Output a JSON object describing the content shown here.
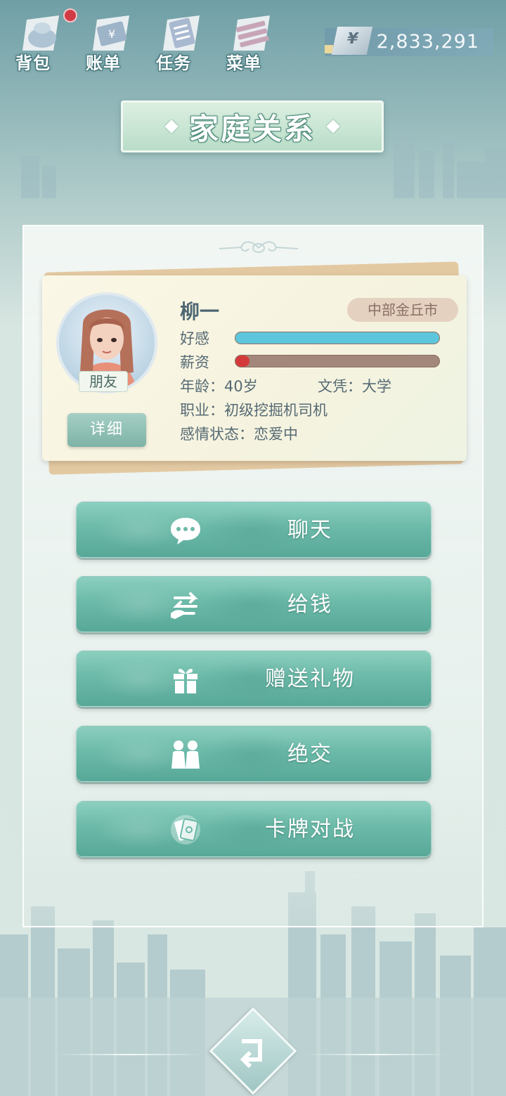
{
  "topnav": {
    "items": [
      {
        "label": "背包",
        "icon": "backpack-icon",
        "badge": true
      },
      {
        "label": "账单",
        "icon": "bill-icon"
      },
      {
        "label": "任务",
        "icon": "task-icon"
      },
      {
        "label": "菜单",
        "icon": "menu-icon"
      }
    ]
  },
  "currency": {
    "symbol": "¥",
    "value": "2,833,291"
  },
  "title": "家庭关系",
  "profile": {
    "name": "柳一",
    "city": "中部金丘市",
    "relation": "朋友",
    "detail_label": "详细",
    "favor_label": "好感",
    "favor_value": 1.0,
    "favor_color": "#5ec6dc",
    "salary_label": "薪资",
    "salary_value": 0.07,
    "salary_color": "#d43a3a",
    "age_text": "年龄：40岁",
    "education_text": "文凭：大学",
    "job_text": "职业：初级挖掘机司机",
    "relationship_text": "感情状态：恋爱中"
  },
  "actions": [
    {
      "label": "聊天",
      "icon": "chat-bubble-icon"
    },
    {
      "label": "给钱",
      "icon": "give-money-icon"
    },
    {
      "label": "赠送礼物",
      "icon": "gift-icon"
    },
    {
      "label": "绝交",
      "icon": "people-icon"
    },
    {
      "label": "卡牌对战",
      "icon": "cards-icon"
    }
  ],
  "back": {
    "icon": "back-arrow-icon"
  },
  "colors": {
    "accent": "#6cbaa9",
    "title_bg": "#c9e7d4"
  }
}
